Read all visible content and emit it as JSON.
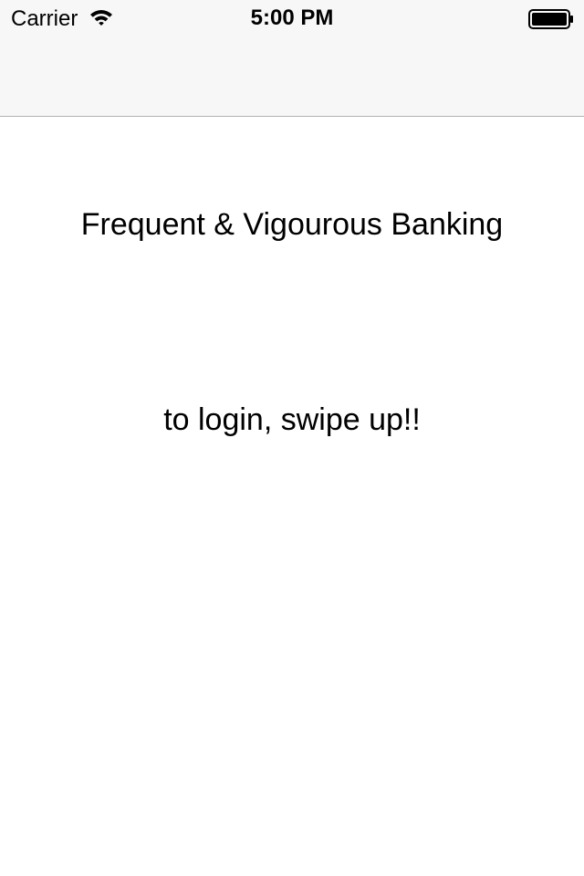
{
  "status_bar": {
    "carrier": "Carrier",
    "time": "5:00 PM",
    "wifi_icon": "wifi-icon",
    "battery_icon": "battery-full-icon"
  },
  "main": {
    "title": "Frequent & Vigourous Banking",
    "login_hint": "to login, swipe up!!"
  },
  "colors": {
    "bar_background": "#f7f7f7",
    "bar_border": "#b2b2b2",
    "background": "#ffffff",
    "text": "#000000"
  }
}
